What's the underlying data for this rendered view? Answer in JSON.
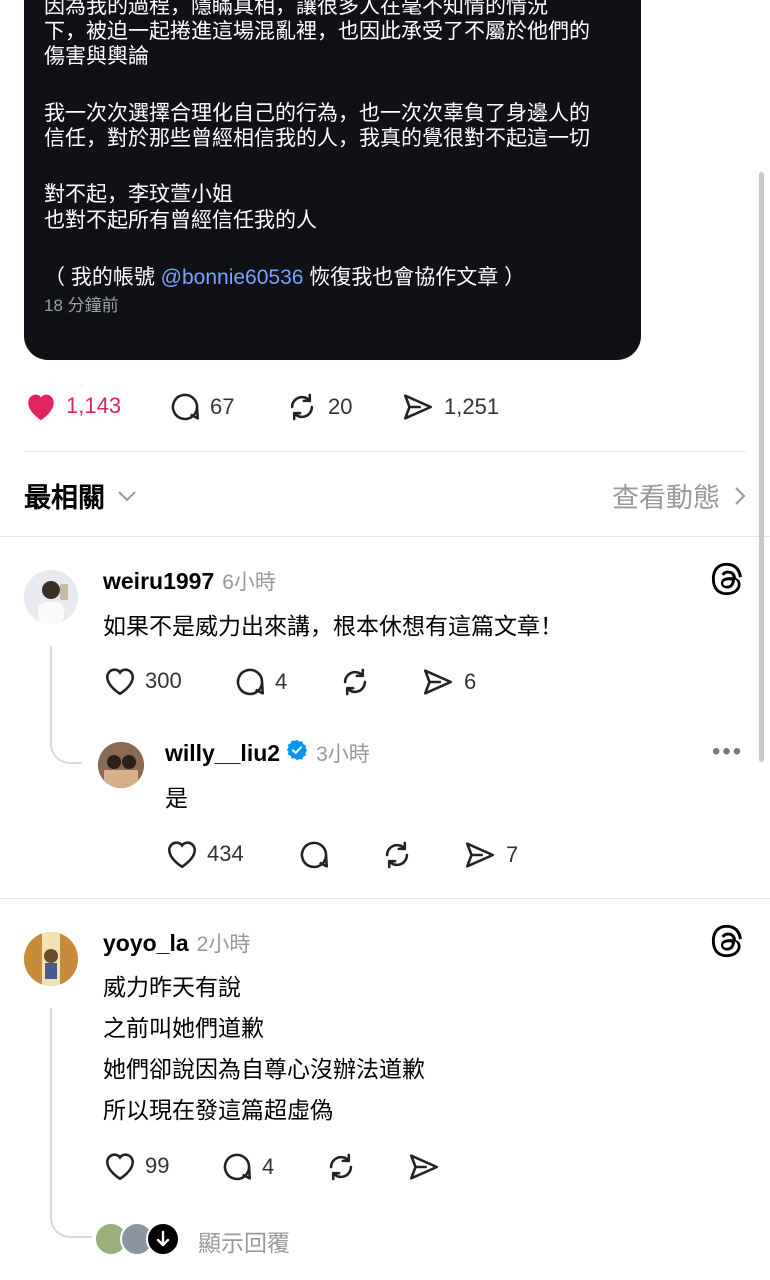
{
  "post": {
    "lines": [
      "因為我的過程，隱瞞真相，讓很多人在毫不知情的情況",
      "下，被迫一起捲進這場混亂裡，也因此承受了不屬於他們的",
      "傷害與輿論",
      "我一次次選擇合理化自己的行為，也一次次辜負了身邊人的",
      "信任，對於那些曾經相信我的人，我真的覺很對不起這一切",
      "對不起，李玟萱小姐",
      "也對不起所有曾經信任我的人"
    ],
    "note_prefix": "（ 我的帳號 ",
    "note_mention": "@bonnie60536",
    "note_suffix": " 恢復我也會協作文章 ）",
    "time": "18 分鐘前",
    "likes": "1,143",
    "comments": "67",
    "reposts": "20",
    "shares": "1,251"
  },
  "sort": {
    "label": "最相關",
    "view_activity": "查看動態"
  },
  "comments": [
    {
      "username": "weiru1997",
      "time": "6小時",
      "text": [
        "如果不是威力出來講，根本休想有這篇文章！"
      ],
      "likes": "300",
      "replies": "4",
      "reposts": "",
      "shares": "6"
    },
    {
      "username": "willy__liu2",
      "time": "3小時",
      "verified": true,
      "text": [
        "是"
      ],
      "likes": "434",
      "replies": "",
      "reposts": "",
      "shares": "7"
    },
    {
      "username": "yoyo_la",
      "time": "2小時",
      "text": [
        "威力昨天有說",
        "之前叫她們道歉",
        "她們卻說因為自尊心沒辦法道歉",
        "所以現在發這篇超虛偽"
      ],
      "likes": "99",
      "replies": "4",
      "reposts": "",
      "shares": ""
    }
  ],
  "show_replies": "顯示回覆",
  "colors": {
    "like_red": "#e0245e",
    "mention_blue": "#7aa3ff",
    "verified_blue": "#0095f6",
    "card_bg": "#101116"
  }
}
